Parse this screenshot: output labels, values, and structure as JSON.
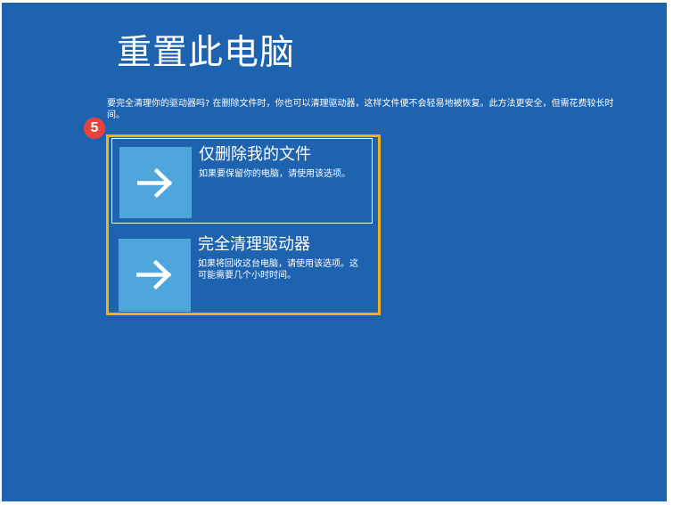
{
  "page": {
    "title": "重置此电脑",
    "description": "要完全清理你的驱动器吗? 在删除文件时，你也可以清理驱动器，这样文件便不会轻易地被恢复。此方法更安全，但需花费较长时间。"
  },
  "step_badge": "5",
  "options": [
    {
      "title": "仅删除我的文件",
      "description": "如果要保留你的电脑，请使用该选项。",
      "icon": "arrow-right-icon"
    },
    {
      "title": "完全清理驱动器",
      "description": "如果将回收这台电脑，请使用该选项。这可能需要几个小时时间。",
      "icon": "arrow-right-icon"
    }
  ],
  "colors": {
    "background": "#1e63b0",
    "tile": "#4ea6dc",
    "highlight": "#f5b014",
    "badge": "#e8433b"
  }
}
